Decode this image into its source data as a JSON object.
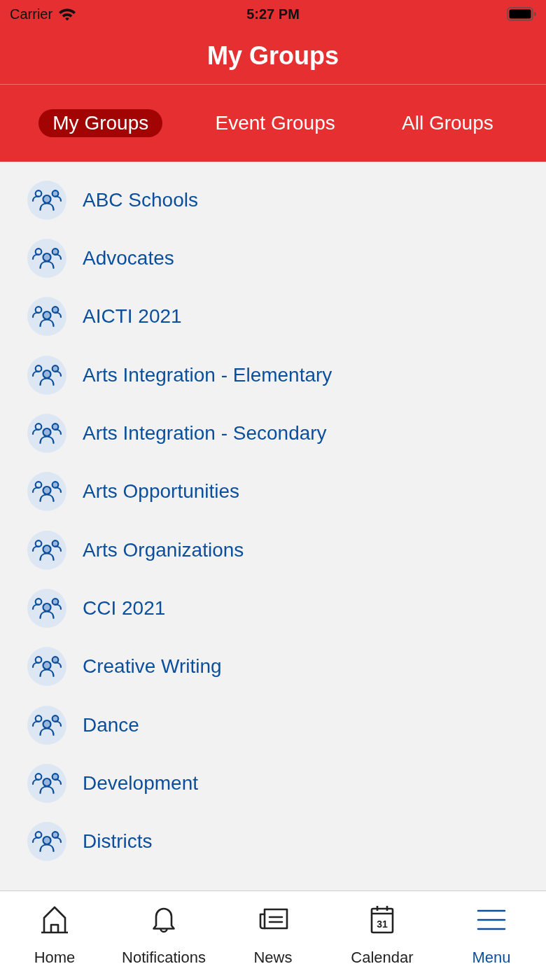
{
  "status_bar": {
    "carrier": "Carrier",
    "time": "5:27 PM"
  },
  "header": {
    "title": "My Groups"
  },
  "tabs": [
    {
      "label": "My Groups",
      "selected": true
    },
    {
      "label": "Event Groups",
      "selected": false
    },
    {
      "label": "All Groups",
      "selected": false
    }
  ],
  "groups": [
    {
      "name": "ABC Schools"
    },
    {
      "name": "Advocates"
    },
    {
      "name": "AICTI 2021"
    },
    {
      "name": "Arts Integration - Elementary"
    },
    {
      "name": "Arts Integration - Secondary"
    },
    {
      "name": "Arts Opportunities"
    },
    {
      "name": "Arts Organizations"
    },
    {
      "name": "CCI 2021"
    },
    {
      "name": "Creative Writing"
    },
    {
      "name": "Dance"
    },
    {
      "name": "Development"
    },
    {
      "name": "Districts"
    }
  ],
  "bottom_nav": [
    {
      "label": "Home",
      "selected": false
    },
    {
      "label": "Notifications",
      "selected": false
    },
    {
      "label": "News",
      "selected": false
    },
    {
      "label": "Calendar",
      "selected": false,
      "icon_text": "31"
    },
    {
      "label": "Menu",
      "selected": true
    }
  ]
}
